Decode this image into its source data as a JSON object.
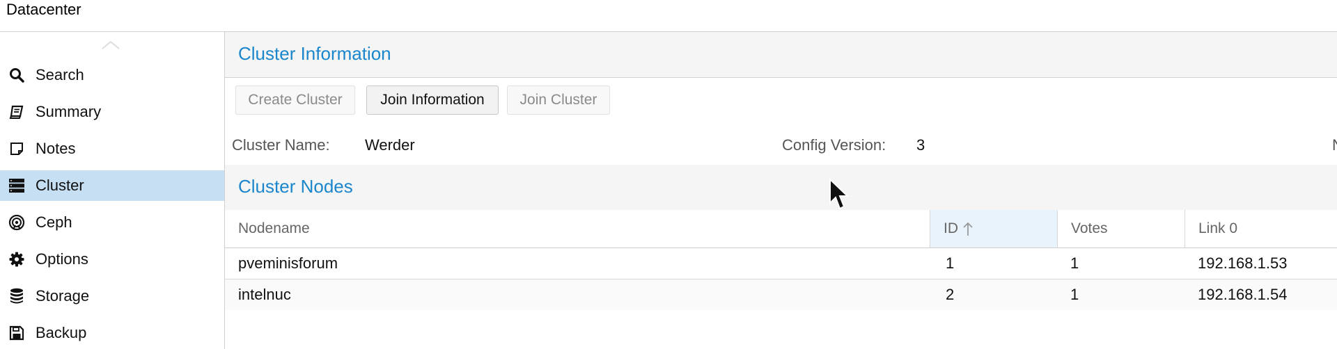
{
  "topbar": {
    "title": "Datacenter"
  },
  "sidebar": {
    "items": [
      {
        "label": "Search",
        "icon": "search-icon"
      },
      {
        "label": "Summary",
        "icon": "book-icon"
      },
      {
        "label": "Notes",
        "icon": "note-icon"
      },
      {
        "label": "Cluster",
        "icon": "server-icon",
        "active": true
      },
      {
        "label": "Ceph",
        "icon": "ceph-icon"
      },
      {
        "label": "Options",
        "icon": "gear-icon"
      },
      {
        "label": "Storage",
        "icon": "database-icon"
      },
      {
        "label": "Backup",
        "icon": "floppy-icon"
      }
    ]
  },
  "cluster_info": {
    "title": "Cluster Information",
    "buttons": {
      "create": "Create Cluster",
      "join_info": "Join Information",
      "join": "Join Cluster"
    },
    "name_label": "Cluster Name:",
    "name_value": "Werder",
    "version_label": "Config Version:",
    "version_value": "3",
    "cut_label": "N"
  },
  "nodes": {
    "title": "Cluster Nodes",
    "columns": {
      "nodename": "Nodename",
      "id": "ID",
      "votes": "Votes",
      "link0": "Link 0"
    },
    "sort": {
      "column": "id",
      "direction": "ascending"
    },
    "rows": [
      {
        "nodename": "pveminisforum",
        "id": "1",
        "votes": "1",
        "link0": "192.168.1.53"
      },
      {
        "nodename": "intelnuc",
        "id": "2",
        "votes": "1",
        "link0": "192.168.1.54"
      }
    ]
  },
  "colors": {
    "accent": "#1b86cc",
    "selected": "#c6dff3",
    "sorted_col": "#e9f3fb"
  }
}
